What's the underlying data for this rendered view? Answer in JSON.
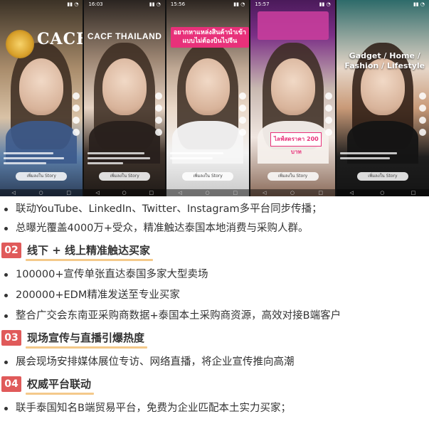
{
  "collage": {
    "tiles": [
      {
        "time": "",
        "logo_text": "CACF",
        "bottom_label": "เพิ่มลงใน Story"
      },
      {
        "time": "16:03",
        "title": "CACF THAILAND",
        "bottom_label": "เพิ่มลงใน Story"
      },
      {
        "time": "15:56",
        "overlay": "อยากหาแหล่งสินค้านำเข้า แบบไม่ต้องบินไปจีน",
        "bottom_label": "เพิ่มลงใน Story"
      },
      {
        "time": "15:57",
        "price": "ไลฟ์สดราคา 200 บาท",
        "bottom_label": "เพิ่มลงใน Story"
      },
      {
        "time": "",
        "overlay": "Gadget / Home / Fashion / Lifestyle",
        "bottom_label": "เพิ่มลงใน Story"
      }
    ]
  },
  "intro_bullets": [
    "联动YouTube、LinkedIn、Twitter、Instagram多平台同步传播；",
    "总曝光覆盖4000万+受众，精准触达泰国本地消费与采购人群。"
  ],
  "sections": [
    {
      "number": "02",
      "title": "线下 + 线上精准触达买家",
      "bullets": [
        "100000+宣传单张直达泰国多家大型卖场",
        "200000+EDM精准发送至专业买家",
        "整合广交会东南亚采购商数据+泰国本土采购商资源，高效对接B端客户"
      ]
    },
    {
      "number": "03",
      "title": "现场宣传与直播引爆热度",
      "bullets": [
        "展会现场安排媒体展位专访、网络直播，将企业宣传推向高潮"
      ]
    },
    {
      "number": "04",
      "title": "权威平台联动",
      "bullets": [
        "联手泰国知名B端贸易平台，免费为企业匹配本土实力买家；"
      ]
    }
  ],
  "colors": {
    "badge": "#e05a5a",
    "underline": "#f4c98a",
    "text": "#333333"
  }
}
